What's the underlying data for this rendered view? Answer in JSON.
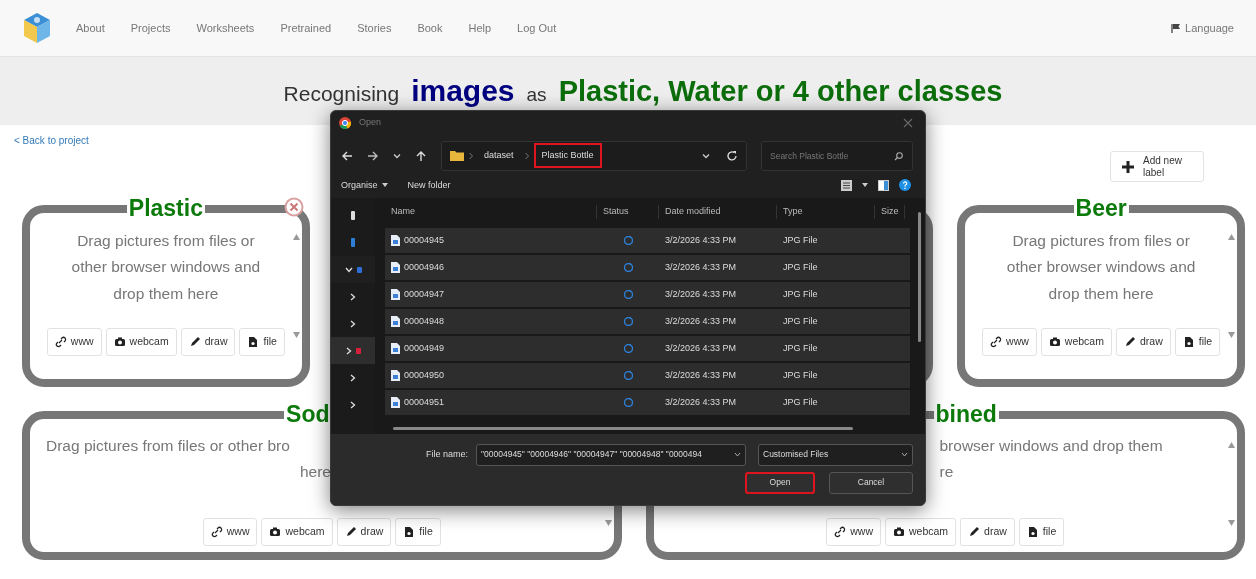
{
  "navbar": {
    "links": [
      "About",
      "Projects",
      "Worksheets",
      "Pretrained",
      "Stories",
      "Book",
      "Help",
      "Log Out"
    ],
    "language": "Language"
  },
  "heading": {
    "prefix": "Recognising",
    "data_type": "images",
    "joiner": "as",
    "classes": "Plastic, Water or 4 other classes"
  },
  "back_link": "< Back to project",
  "add_label_button": "Add new label",
  "label_rows": [
    [
      {
        "kind": "full",
        "title": "Plastic",
        "deletable": true,
        "prompt": "Drag pictures from files or other browser windows and drop them here",
        "buttons": [
          {
            "kind": "link",
            "label": "www"
          },
          {
            "kind": "camera",
            "label": "webcam"
          },
          {
            "kind": "pencil",
            "label": "draw"
          },
          {
            "kind": "file",
            "label": "file"
          }
        ]
      },
      {
        "kind": "covered"
      },
      {
        "kind": "full",
        "title": "Beer",
        "deletable": false,
        "prompt": "Drag pictures from files or other browser windows and drop them here",
        "buttons": [
          {
            "kind": "link",
            "label": "www"
          },
          {
            "kind": "camera",
            "label": "webcam"
          },
          {
            "kind": "pencil",
            "label": "draw"
          },
          {
            "kind": "file",
            "label": "file"
          }
        ]
      }
    ],
    [
      {
        "kind": "cut_right",
        "title": "Sod",
        "prompt_lines": [
          "Drag pictures from files or other bro",
          "here"
        ],
        "buttons": [
          {
            "kind": "link",
            "label": "www"
          },
          {
            "kind": "camera",
            "label": "webcam"
          },
          {
            "kind": "pencil",
            "label": "draw"
          },
          {
            "kind": "file",
            "label": "file"
          }
        ]
      },
      {
        "kind": "cut_left",
        "title": "bined",
        "prompt_lines": [
          "browser windows and drop them",
          "re"
        ],
        "buttons": [
          {
            "kind": "link",
            "label": "www"
          },
          {
            "kind": "camera",
            "label": "webcam"
          },
          {
            "kind": "pencil",
            "label": "draw"
          },
          {
            "kind": "file",
            "label": "file"
          }
        ]
      }
    ]
  ],
  "dialog": {
    "title": "Open",
    "path": [
      {
        "label": "dataset",
        "highlighted": false
      },
      {
        "label": "Plastic Bottle",
        "highlighted": true
      }
    ],
    "search": {
      "placeholder": "Search Plastic Bottle"
    },
    "commands": [
      {
        "label": "Organise",
        "dropdown": true
      },
      {
        "label": "New folder",
        "dropdown": false
      }
    ],
    "nav_pane": [
      {
        "kind": "pin",
        "selected": false
      },
      {
        "kind": "pin",
        "selected": false
      },
      {
        "kind": "folder",
        "expanded": true,
        "selected": false
      },
      {
        "kind": "folder",
        "expanded": false,
        "selected": false
      },
      {
        "kind": "folder",
        "expanded": false,
        "selected": false
      },
      {
        "kind": "folder",
        "expanded": false,
        "selected": true
      },
      {
        "kind": "folder",
        "expanded": false,
        "selected": false
      },
      {
        "kind": "folder",
        "expanded": false,
        "selected": false
      }
    ],
    "columns": [
      "Name",
      "Status",
      "Date modified",
      "Type",
      "Size"
    ],
    "files": [
      {
        "name": "00004945",
        "date": "3/2/2026 4:33 PM",
        "type": "JPG File",
        "selected": true
      },
      {
        "name": "00004946",
        "date": "3/2/2026 4:33 PM",
        "type": "JPG File",
        "selected": true
      },
      {
        "name": "00004947",
        "date": "3/2/2026 4:33 PM",
        "type": "JPG File",
        "selected": true
      },
      {
        "name": "00004948",
        "date": "3/2/2026 4:33 PM",
        "type": "JPG File",
        "selected": true
      },
      {
        "name": "00004949",
        "date": "3/2/2026 4:33 PM",
        "type": "JPG File",
        "selected": true
      },
      {
        "name": "00004950",
        "date": "3/2/2026 4:33 PM",
        "type": "JPG File",
        "selected": true
      },
      {
        "name": "00004951",
        "date": "3/2/2026 4:33 PM",
        "type": "JPG File",
        "selected": true
      }
    ],
    "file_name_label": "File name:",
    "file_name": "\"00004945\" \"00004946\" \"00004947\" \"00004948\" \"0000494",
    "file_type": "Customised Files",
    "buttons": [
      {
        "label": "Open",
        "highlighted": true
      },
      {
        "label": "Cancel",
        "highlighted": false
      }
    ]
  }
}
